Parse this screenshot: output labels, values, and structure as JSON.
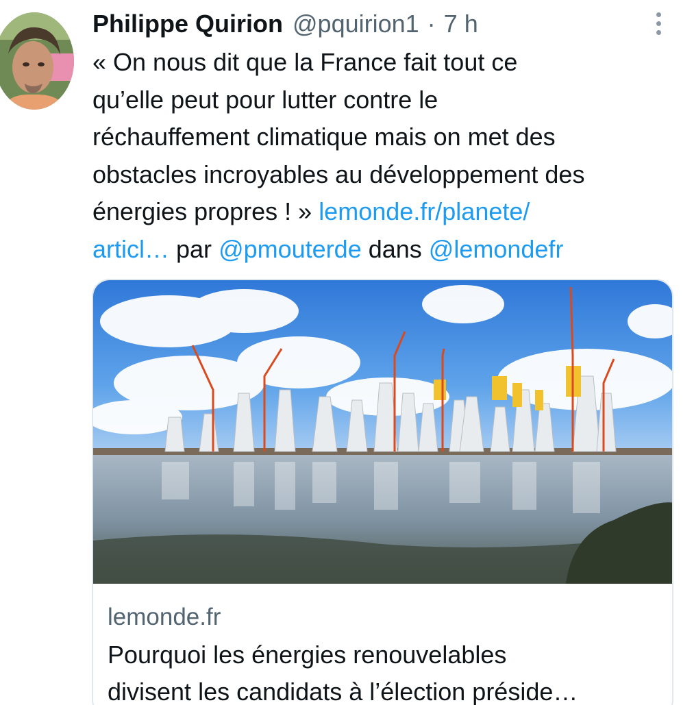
{
  "tweet": {
    "author_name": "Philippe Quirion",
    "author_handle": "@pquirion1",
    "separator": "·",
    "time": "7 h",
    "text_lines": [
      "« On nous dit que la France fait tout ce",
      "qu’elle peut pour lutter contre le",
      "réchauffement climatique mais on met des",
      "obstacles incroyables au développement des"
    ],
    "text_line5_prefix": "énergies propres ! » ",
    "link_part1": "lemonde.fr/planete/",
    "link_part2": "articl…",
    "text_par": " par ",
    "mention_author": "@pmouterde",
    "text_dans": " dans ",
    "mention_outlet": "@lemondefr"
  },
  "card": {
    "domain": "lemonde.fr",
    "title_line1": "Pourquoi les énergies renouvelables",
    "title_line2": "divisent les candidats à l’élection préside…"
  },
  "icons": {
    "more": "more-vertical-icon",
    "avatar": "profile-photo"
  },
  "colors": {
    "link": "#1d9bf0",
    "secondary_text": "#536471",
    "primary_text": "#0f1419"
  }
}
